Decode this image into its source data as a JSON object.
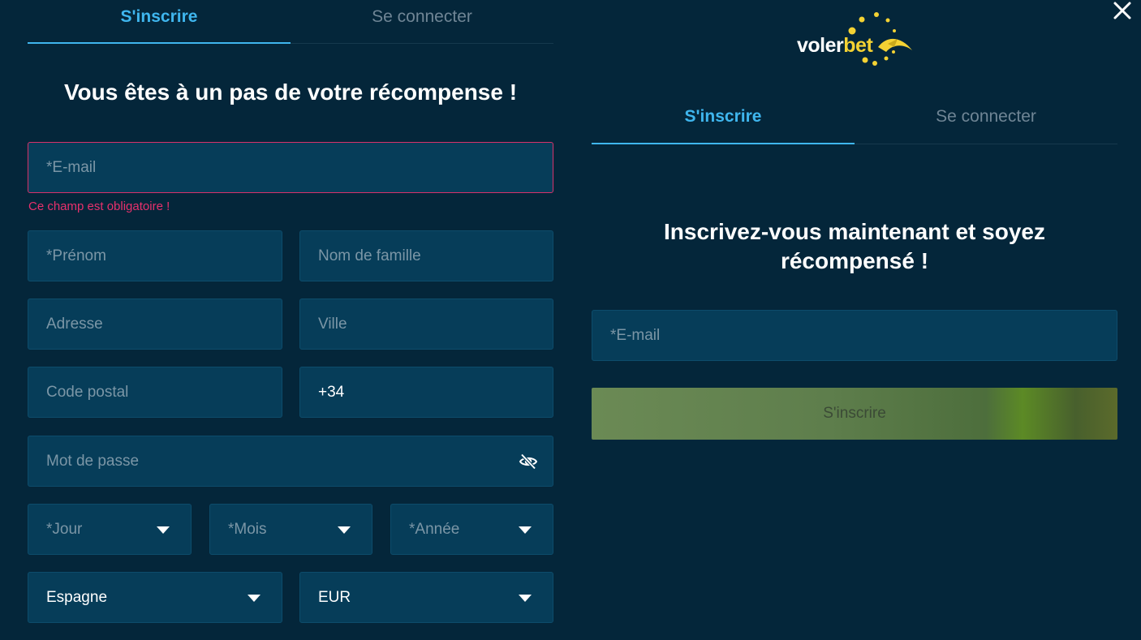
{
  "left_panel": {
    "tabs": [
      {
        "label": "S'inscrire",
        "active": true
      },
      {
        "label": "Se connecter",
        "active": false
      }
    ],
    "heading": "Vous êtes à un pas de votre récompense !",
    "email": {
      "placeholder": "*E-mail"
    },
    "email_error": "Ce champ est obligatoire !",
    "first_name": {
      "placeholder": "*Prénom"
    },
    "last_name": {
      "placeholder": "Nom de famille"
    },
    "address": {
      "placeholder": "Adresse"
    },
    "city": {
      "placeholder": "Ville"
    },
    "postal_code": {
      "placeholder": "Code postal"
    },
    "phone_prefix": {
      "value": "+34"
    },
    "password": {
      "placeholder": "Mot de passe"
    },
    "day": {
      "placeholder": "*Jour"
    },
    "month": {
      "placeholder": "*Mois"
    },
    "year": {
      "placeholder": "*Année"
    },
    "country": {
      "value": "Espagne"
    },
    "currency": {
      "value": "EUR"
    }
  },
  "right_panel": {
    "logo": {
      "part1": "voler",
      "part2": "bet"
    },
    "tabs": [
      {
        "label": "S'inscrire",
        "active": true
      },
      {
        "label": "Se connecter",
        "active": false
      }
    ],
    "heading_line1": "Inscrivez-vous maintenant et soyez",
    "heading_line2": "récompensé !",
    "email": {
      "placeholder": "*E-mail"
    },
    "submit_label": "S'inscrire"
  },
  "icons": {
    "close": "close-icon",
    "password_toggle": "eye-slash-icon",
    "dropdown": "chevron-down-icon"
  },
  "colors": {
    "background": "#04263a",
    "field": "#063d59",
    "accent": "#3fb6ee",
    "error": "#e8306c",
    "brand_yellow": "#f4d233"
  }
}
